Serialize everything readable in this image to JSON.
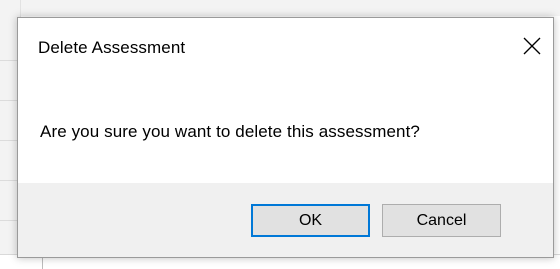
{
  "dialog": {
    "title": "Delete Assessment",
    "message": "Are you sure you want to delete this assessment?",
    "close_icon": "close-icon",
    "buttons": {
      "ok_label": "OK",
      "cancel_label": "Cancel"
    },
    "colors": {
      "focus_border": "#0078d7",
      "footer_bg": "#f0f0f0",
      "button_bg": "#e1e1e1"
    }
  }
}
